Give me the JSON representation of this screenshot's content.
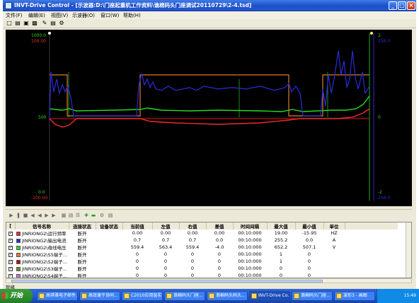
{
  "window": {
    "title": "INVT-Drive Control - [示波器:D:\\门座起重机工作资料\\谯棉码头门座调试20110729\\2-4.tsd]",
    "controls": [
      "_",
      "□",
      "×"
    ]
  },
  "menu": [
    "文件(F)",
    "编辑(E)",
    "视图(V)",
    "示波器(O)",
    "窗口(W)",
    "帮助(H)"
  ],
  "chart": {
    "left_axis_top": "1000.0",
    "left_axis_top2": "100.00",
    "left_axis_mid": "500",
    "left_axis_bottom": "0.0",
    "left_axis_bottom2": "-100.00",
    "right_axis_top": "2",
    "right_axis_top2": "256.0",
    "right_axis_mid": "0",
    "right_axis_bottom": "-2",
    "right_axis_bottom2": "-256.0",
    "colors": {
      "blue": "#2b2bd8",
      "green": "#22dd22",
      "red": "#ee2b2b",
      "orange": "#e07a2b",
      "dark_red": "#b01010",
      "grid": "#1a3a1a"
    }
  },
  "table": {
    "headers": [
      "[",
      "信号名称",
      "连接状态",
      "设备状态",
      "当前值",
      "左值",
      "右值",
      "差值",
      "时间间隔",
      "最大值",
      "最小值",
      "单位"
    ],
    "rows": [
      {
        "color": "#ee2b2b",
        "name": "JINRIONG2\\运行频率",
        "conn": "断开",
        "dev": "",
        "cur": "0.00",
        "left": "0.00",
        "right": "0.00",
        "diff": "0.00",
        "interval": "00:10:000",
        "max": "19.00",
        "min": "-15.95",
        "unit": "HZ"
      },
      {
        "color": "#2b2bd8",
        "name": "JINRIONG2\\输出电流",
        "conn": "断开",
        "dev": "",
        "cur": "0.7",
        "left": "0.7",
        "right": "0.7",
        "diff": "0.0",
        "interval": "00:10:000",
        "max": "255.2",
        "min": "0.0",
        "unit": "A"
      },
      {
        "color": "#22dd22",
        "name": "JINRIONG2\\母线电压",
        "conn": "断开",
        "dev": "",
        "cur": "559.4",
        "left": "563.4",
        "right": "559.4",
        "diff": "-4.0",
        "interval": "00:10:000",
        "max": "652.2",
        "min": "507.1",
        "unit": "V"
      },
      {
        "color": "#e07a2b",
        "name": "JINRIONG2\\S5端子...",
        "conn": "断开",
        "dev": "",
        "cur": "0",
        "left": "0",
        "right": "0",
        "diff": "0",
        "interval": "00:10:000",
        "max": "1",
        "min": "0",
        "unit": ""
      },
      {
        "color": "#b01010",
        "name": "JINRIONG2\\S2端子...",
        "conn": "断开",
        "dev": "",
        "cur": "0",
        "left": "0",
        "right": "0",
        "diff": "0",
        "interval": "00:10:000",
        "max": "1",
        "min": "0",
        "unit": ""
      },
      {
        "color": "#6b8e23",
        "name": "JINRIONG2\\S3端子...",
        "conn": "断开",
        "dev": "",
        "cur": "0",
        "left": "0",
        "right": "0",
        "diff": "0",
        "interval": "00:10:000",
        "max": "0",
        "min": "0",
        "unit": ""
      },
      {
        "color": "#c86bd8",
        "name": "JINRIONG2\\S4端子...",
        "conn": "断开",
        "dev": "",
        "cur": "0",
        "left": "0",
        "right": "0",
        "diff": "0",
        "interval": "00:10:000",
        "max": "0",
        "min": "0",
        "unit": ""
      }
    ]
  },
  "status": "就绪",
  "taskbar": {
    "start": "开始",
    "tasks": [
      "高祺雅电子邮件...",
      "高效便于协同...",
      "C2010应用层实...",
      "谯棉码头门座...",
      "谯棉码头码头...",
      "INVT-Drive Co...",
      "谯棉码头门座...",
      "波形3 - 画图"
    ],
    "clock": "15:49"
  }
}
